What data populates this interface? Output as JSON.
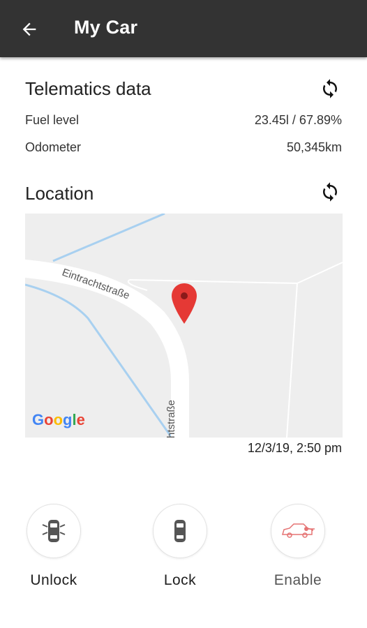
{
  "appbar": {
    "title": "My Car",
    "back_icon": "arrow-left-icon",
    "background": "#333333"
  },
  "telematics": {
    "title": "Telematics data",
    "refresh_icon": "refresh-icon",
    "rows": [
      {
        "label": "Fuel level",
        "value": "23.45l / 67.89%"
      },
      {
        "label": "Odometer",
        "value": "50,345km"
      }
    ]
  },
  "location": {
    "title": "Location",
    "refresh_icon": "refresh-icon",
    "map": {
      "street_label_1": "Eintrachtstraße",
      "street_label_2": "Eintrachtstraße",
      "logo": "Google",
      "marker_color": "#e53935"
    },
    "timestamp": "12/3/19, 2:50 pm"
  },
  "actions": [
    {
      "label": "Unlock",
      "icon": "car-unlock-icon",
      "color": "#555555"
    },
    {
      "label": "Lock",
      "icon": "car-lock-icon",
      "color": "#555555"
    },
    {
      "label": "Enable",
      "icon": "car-key-icon",
      "color": "#e57373"
    }
  ]
}
